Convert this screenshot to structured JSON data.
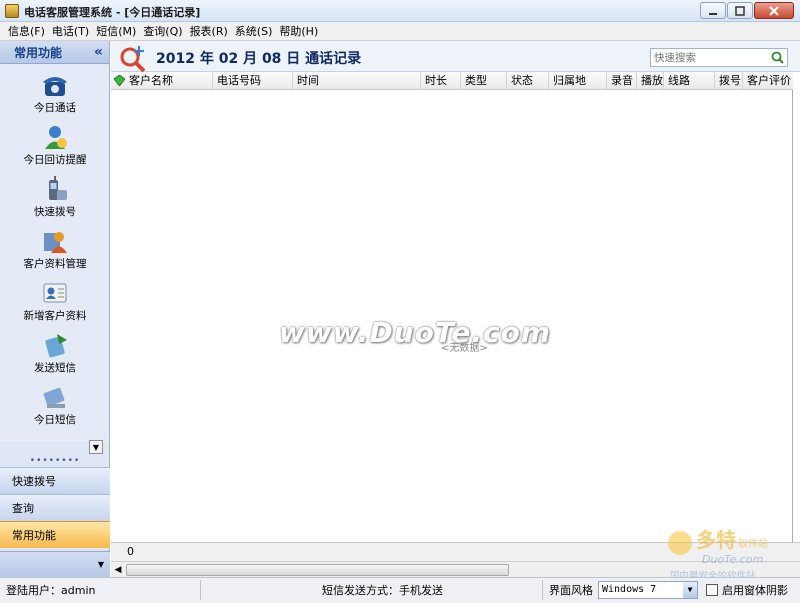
{
  "window": {
    "title": "电话客服管理系统 - [今日通话记录]"
  },
  "menu": [
    {
      "label": "信息(F)"
    },
    {
      "label": "电话(T)"
    },
    {
      "label": "短信(M)"
    },
    {
      "label": "查询(Q)"
    },
    {
      "label": "报表(R)"
    },
    {
      "label": "系统(S)"
    },
    {
      "label": "帮助(H)"
    }
  ],
  "sidebar": {
    "title": "常用功能",
    "items": [
      {
        "label": "今日通话",
        "icon": "phone-icon"
      },
      {
        "label": "今日回访提醒",
        "icon": "user-reminder-icon"
      },
      {
        "label": "快速拨号",
        "icon": "mobile-phone-icon"
      },
      {
        "label": "客户资料管理",
        "icon": "customer-data-icon"
      },
      {
        "label": "新增客户资料",
        "icon": "add-customer-icon"
      },
      {
        "label": "发送短信",
        "icon": "send-sms-icon"
      },
      {
        "label": "今日短信",
        "icon": "today-sms-icon"
      }
    ],
    "nav": [
      {
        "label": "快速拨号"
      },
      {
        "label": "查询"
      },
      {
        "label": "常用功能",
        "active": true
      }
    ]
  },
  "main": {
    "title": "2012 年 02 月 08 日  通话记录",
    "search_placeholder": "快速搜索",
    "columns": [
      {
        "label": "客户名称"
      },
      {
        "label": "电话号码"
      },
      {
        "label": "时间"
      },
      {
        "label": "时长"
      },
      {
        "label": "类型"
      },
      {
        "label": "状态"
      },
      {
        "label": "归属地"
      },
      {
        "label": "录音"
      },
      {
        "label": "播放"
      },
      {
        "label": "线路"
      },
      {
        "label": "拨号"
      },
      {
        "label": "客户评价"
      }
    ],
    "empty_text": "<无数据>",
    "watermark": "www.DuoTe.com",
    "summary_count": "0"
  },
  "statusbar": {
    "user": "登陆用户：admin",
    "sms_mode": "短信发送方式：手机发送",
    "skin_label": "界面风格",
    "skin_value": "Windows 7",
    "shadow_label": "启用窗体阴影"
  },
  "corner_logo": {
    "brand": "多特",
    "tag": "软件站",
    "domain": "DuoTe.com",
    "slogan": "国内最安全的软件站"
  },
  "colors": {
    "accent": "#15428b",
    "active_nav": "#f7b94d",
    "sidebar_bg": "#dfe7f4"
  }
}
